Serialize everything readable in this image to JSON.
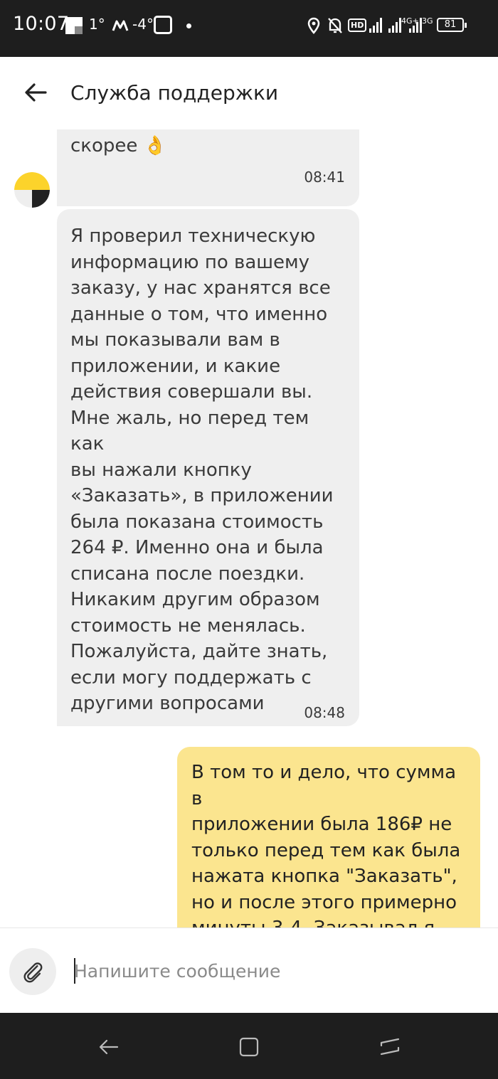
{
  "status_bar": {
    "time": "10:07",
    "temp_1": "1°",
    "temp_2": "-4°",
    "hd": "HD",
    "net_1": "4G+",
    "net_2": "3G",
    "battery": "81"
  },
  "header": {
    "title": "Служба поддержки"
  },
  "messages": [
    {
      "text": "Постараюсь как можно\nскорее 👌",
      "time": "08:41"
    },
    {
      "text": "Я проверил техническую\nинформацию по вашему\nзаказу, у нас хранятся все\nданные о том, что именно\nмы показывали вам в\nприложении, и какие\nдействия совершали вы.\nМне жаль, но перед тем как\nвы нажали кнопку\n«Заказать», в приложении\nбыла показана стоимость\n264 ₽. Именно она и была\nсписана после поездки.\nНикаким другим образом\nстоимость не менялась.\nПожалуйста, дайте знать,\nесли могу поддержать с\nдругими вопросами",
      "time": "08:48"
    },
    {
      "text": "В том то и дело, что сумма в\nприложении была 186₽ не\nтолько перед тем как была\nнажата кнопка \"Заказать\",\nно и после этого примерно\nминуты 3-4. Заказывал я\nтакси находясь ещё дома, и"
    }
  ],
  "composer": {
    "placeholder": "Напишите сообщение"
  },
  "icons": {
    "back": "arrow-left-icon",
    "attach": "paperclip-icon",
    "nav_back": "nav-back-icon",
    "nav_home": "nav-home-icon",
    "nav_recents": "nav-recents-icon"
  },
  "colors": {
    "incoming_bubble": "#efefef",
    "outgoing_bubble": "#fbe58f",
    "system_bars": "#1e1e1e",
    "avatar_yellow": "#fcd32b"
  }
}
